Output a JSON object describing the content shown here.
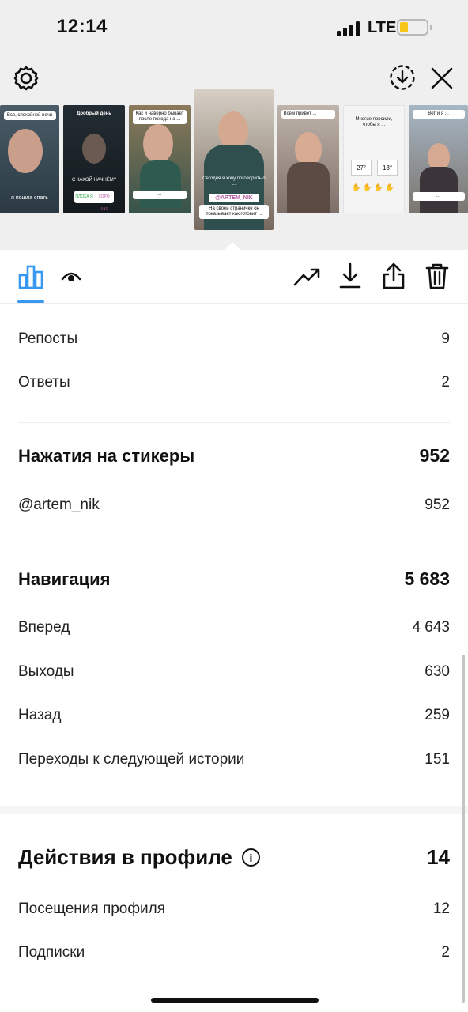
{
  "status_bar": {
    "time": "12:14",
    "network": "LTE",
    "battery_level": 0.2
  },
  "header": {
    "settings_icon": "gear-icon",
    "save_icon": "download-circle-icon",
    "close_icon": "close-icon"
  },
  "thumbnails": [
    {
      "caption_top": "Все, спокойной ночи",
      "caption_bottom": "я пошла спать",
      "bg": "#3a4a55"
    },
    {
      "caption_top": "Дообрый день",
      "caption_mid": "С КАКОЙ НАЧНЁМ?",
      "opt1": "ПЛОХА Я",
      "opt2": "ХОРО ШАЯ",
      "bg": "#1d2a30"
    },
    {
      "caption_top": "Как и наверно бывает после похода на ...",
      "caption_bottom": "...",
      "bg": "#4b6a5a"
    },
    {
      "caption_top": "Сегодня я хочу поговорить о ...",
      "tag": "@ARTEM_NIK",
      "caption_bottom": "На своей страничке он показывает как готовит ...",
      "bg": "#7a6e63"
    },
    {
      "caption_top": "Всем привет ...",
      "caption_bottom": "",
      "bg": "#a79a93"
    },
    {
      "caption_top": "Многие просили, чтобы я ...",
      "temp1": "27°",
      "temp2": "13°",
      "bg": "#f4f4f4"
    },
    {
      "caption_top": "Вот и я ...",
      "caption_bottom": "...",
      "bg": "#8a96a3"
    }
  ],
  "toolbar": {
    "insights_icon": "bar-chart-icon",
    "viewers_icon": "eye-icon",
    "promote_icon": "trend-up-icon",
    "download_icon": "download-icon",
    "share_icon": "share-icon",
    "delete_icon": "trash-icon"
  },
  "interactions": [
    {
      "label": "Репосты",
      "value": "9"
    },
    {
      "label": "Ответы",
      "value": "2"
    }
  ],
  "stickers": {
    "title": "Нажатия на стикеры",
    "total": "952",
    "items": [
      {
        "label": "@artem_nik",
        "value": "952"
      }
    ]
  },
  "navigation": {
    "title": "Навигация",
    "total": "5 683",
    "items": [
      {
        "label": "Вперед",
        "value": "4 643"
      },
      {
        "label": "Выходы",
        "value": "630"
      },
      {
        "label": "Назад",
        "value": "259"
      },
      {
        "label": "Переходы к следующей истории",
        "value": "151"
      }
    ]
  },
  "profile_actions": {
    "title": "Действия в профиле",
    "info_glyph": "i",
    "total": "14",
    "items": [
      {
        "label": "Посещения профиля",
        "value": "12"
      },
      {
        "label": "Подписки",
        "value": "2"
      }
    ]
  },
  "colors": {
    "accent": "#3897f0",
    "background_top": "#efefef",
    "text": "#111111"
  }
}
